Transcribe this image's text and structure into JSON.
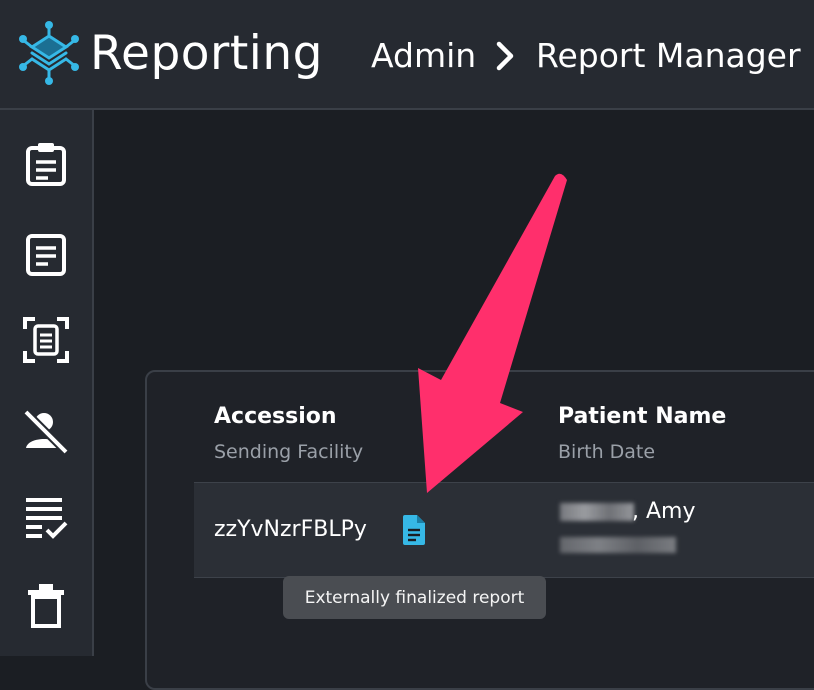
{
  "header": {
    "app_title": "Reporting",
    "breadcrumb": [
      "Admin",
      "Report Manager"
    ],
    "logo_icon": "circuit-logo-icon"
  },
  "sidebar": {
    "items": [
      {
        "icon": "clipboard-icon"
      },
      {
        "icon": "document-icon"
      },
      {
        "icon": "scan-document-icon"
      },
      {
        "icon": "user-off-icon"
      },
      {
        "icon": "checklist-icon"
      },
      {
        "icon": "trash-icon"
      }
    ]
  },
  "table": {
    "columns": [
      {
        "header": "Accession",
        "subheader": "Sending Facility"
      },
      {
        "header": "Patient Name",
        "subheader": "Birth Date"
      }
    ],
    "rows": [
      {
        "accession": "zzYvNzrFBLPy",
        "patient_name_suffix": ", Amy",
        "status_icon": "file-document-icon"
      }
    ]
  },
  "tooltip": {
    "text": "Externally finalized report"
  },
  "colors": {
    "background": "#1b1e23",
    "topbar": "#262a31",
    "accent": "#36b8e6",
    "annotation_arrow": "#ff2f6c",
    "tooltip_bg": "#4a4d52"
  }
}
